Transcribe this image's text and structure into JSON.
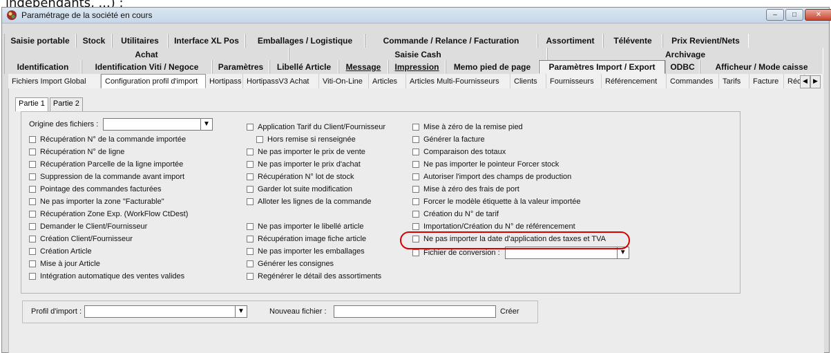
{
  "header_caption": "indépendants, ...) :",
  "window": {
    "title": "Paramétrage de la société en cours",
    "controls": {
      "minimize": "–",
      "maximize": "□",
      "close": "✕"
    }
  },
  "tabs": {
    "row1": [
      "Saisie portable",
      "Stock",
      "Utilitaires",
      "Interface XL Pos",
      "Emballages / Logistique",
      "Commande / Relance / Facturation",
      "Assortiment",
      "Télévente",
      "Prix Revient/Nets"
    ],
    "row2": [
      "Achat",
      "Saisie Cash",
      "Archivage"
    ],
    "row3": [
      "Identification",
      "Identification Viti / Negoce",
      "Paramètres",
      "Libellé Article",
      "Message",
      "Impression",
      "Memo pied de page",
      "Paramètres Import / Export",
      "ODBC",
      "Afficheur / Mode caisse"
    ]
  },
  "subtabs": [
    "Fichiers Import Global",
    "Configuration profil d'import",
    "Hortipass",
    "HortipassV3 Achat",
    "Viti-On-Line",
    "Articles",
    "Articles Multi-Fournisseurs",
    "Clients",
    "Fournisseurs",
    "Référencement",
    "Commandes",
    "Tarifs",
    "Facture",
    "Réc"
  ],
  "parts": [
    "Partie 1",
    "Partie 2"
  ],
  "origin_label": "Origine des fichiers :",
  "origin_value": "",
  "col1": [
    "Récupération N° de la commande importée",
    "Récupération N° de ligne",
    "Récupération Parcelle de la ligne importée",
    "Suppression de la commande avant import",
    "Pointage des commandes facturées",
    "Ne pas importer la zone \"Facturable\"",
    "Récupération Zone Exp. (WorkFlow CtDest)",
    "Demander le Client/Fournisseur",
    "Création Client/Fournisseur",
    "Création Article",
    "Mise à jour Article",
    "Intégration automatique des ventes valides"
  ],
  "col2": [
    "Application Tarif du Client/Fournisseur",
    "Hors remise si renseignée",
    "Ne pas importer le prix de vente",
    "Ne pas importer le prix d'achat",
    "Récupération N° lot de stock",
    "Garder lot suite modification",
    "Alloter les lignes de la commande",
    "Ne pas importer le libellé article",
    "Récupération image fiche article",
    "Ne pas importer les emballages",
    "Générer les consignes",
    "Regénérer le détail des assortiments"
  ],
  "col3": [
    "Mise à zéro de la remise pied",
    "Générer la facture",
    "Comparaison des totaux",
    "Ne pas importer le pointeur Forcer stock",
    "Autoriser l'import des champs de production",
    "Mise à zéro des frais de port",
    "Forcer le modèle étiquette à la valeur importée",
    "Création du N° de tarif",
    "Importation/Création du N° de référencement",
    "Ne pas importer la date d'application des taxes et TVA",
    "Fichier de conversion :"
  ],
  "conversion_value": "",
  "bottom": {
    "profil_label": "Profil d'import :",
    "profil_value": "",
    "nouveau_label": "Nouveau fichier :",
    "nouveau_value": "",
    "creer_label": "Créer"
  },
  "colors": {
    "highlight": "#d50000"
  }
}
